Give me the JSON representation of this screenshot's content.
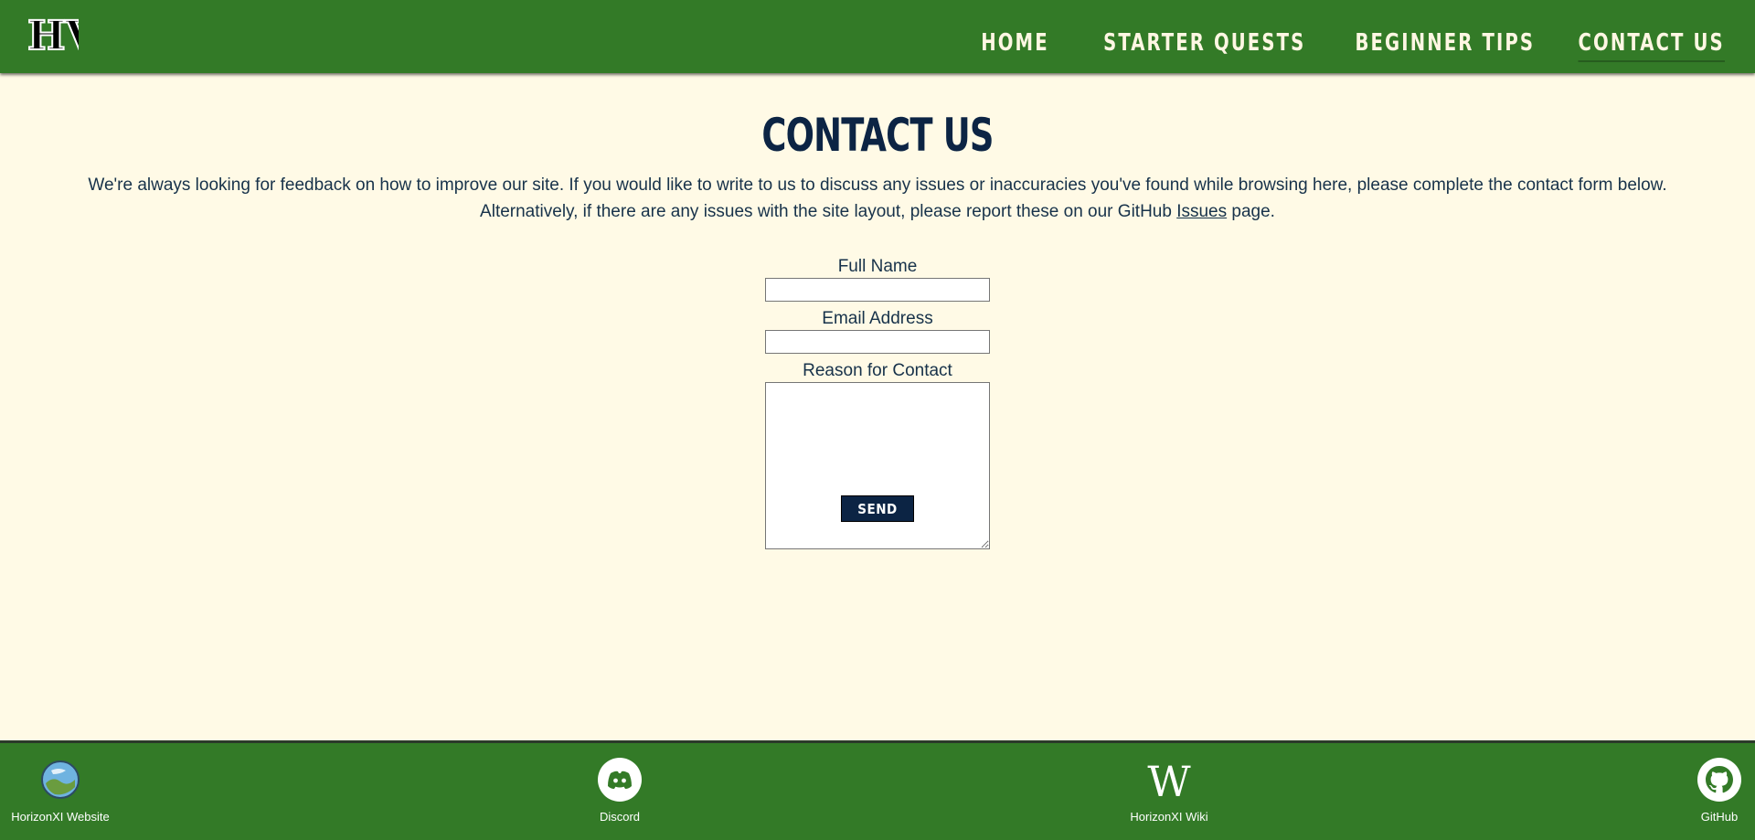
{
  "header": {
    "logo_text": "HV",
    "nav": [
      {
        "label": "HOME",
        "active": false
      },
      {
        "label": "STARTER QUESTS",
        "active": false
      },
      {
        "label": "BEGINNER TIPS",
        "active": false
      },
      {
        "label": "CONTACT US",
        "active": true
      }
    ]
  },
  "main": {
    "title": "CONTACT US",
    "intro_line1": "We're always looking for feedback on how to improve our site. If you would like to write to us to discuss any issues or inaccuracies you've found while browsing here, please complete the contact form below.",
    "intro_line2_before": "Alternatively, if there are any issues with the site layout, please report these on our GitHub ",
    "intro_line2_link": "Issues",
    "intro_line2_after": " page."
  },
  "form": {
    "full_name_label": "Full Name",
    "full_name_value": "",
    "email_label": "Email Address",
    "email_value": "",
    "reason_label": "Reason for Contact",
    "reason_value": "",
    "send_label": "SEND"
  },
  "footer": {
    "links": [
      {
        "label": "HorizonXI Website",
        "icon": "globe-icon"
      },
      {
        "label": "Discord",
        "icon": "discord-icon"
      },
      {
        "label": "HorizonXI Wiki",
        "icon": "wikipedia-icon"
      },
      {
        "label": "GitHub",
        "icon": "github-icon"
      }
    ]
  },
  "colors": {
    "header_bg": "#337a27",
    "page_bg": "#fffae6",
    "title": "#0c2444",
    "button_bg": "#0c2444"
  }
}
